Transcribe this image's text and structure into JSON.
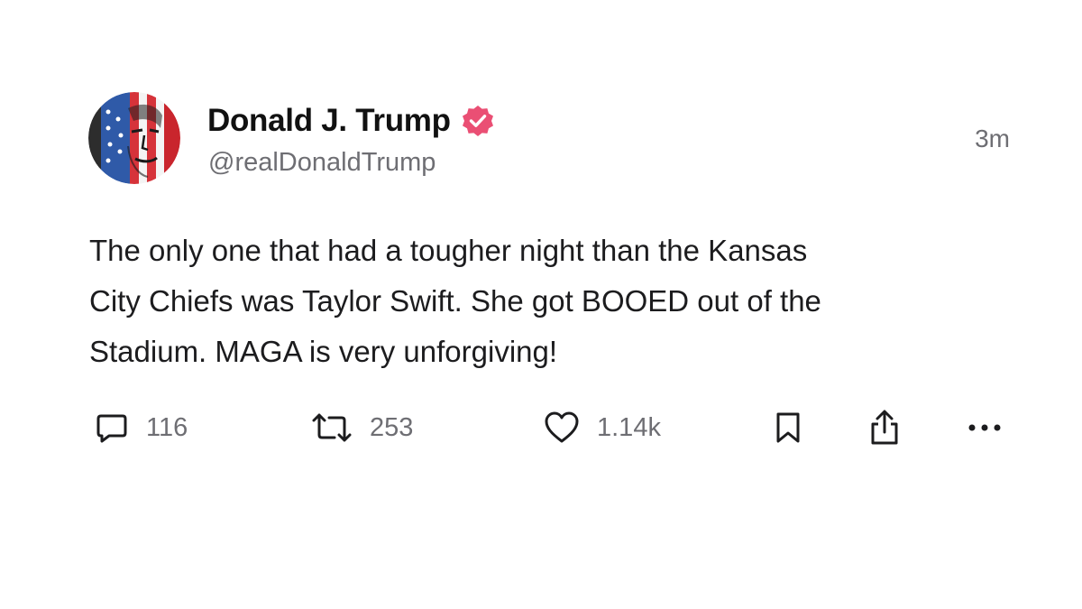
{
  "post": {
    "author": {
      "display_name": "Donald J. Trump",
      "handle": "@realDonaldTrump",
      "verified": true,
      "badge_color": "#ea4f74"
    },
    "timestamp": "3m",
    "text": "The only one that had a tougher night than the Kansas\nCity Chiefs was Taylor Swift. She got BOOED out of the\nStadium. MAGA is very unforgiving!",
    "actions": {
      "reply": {
        "icon": "comment-icon",
        "count": "116"
      },
      "repost": {
        "icon": "repost-icon",
        "count": "253"
      },
      "like": {
        "icon": "heart-icon",
        "count": "1.14k"
      },
      "bookmark": {
        "icon": "bookmark-icon"
      },
      "share": {
        "icon": "share-icon"
      },
      "more": {
        "icon": "more-icon"
      }
    }
  }
}
